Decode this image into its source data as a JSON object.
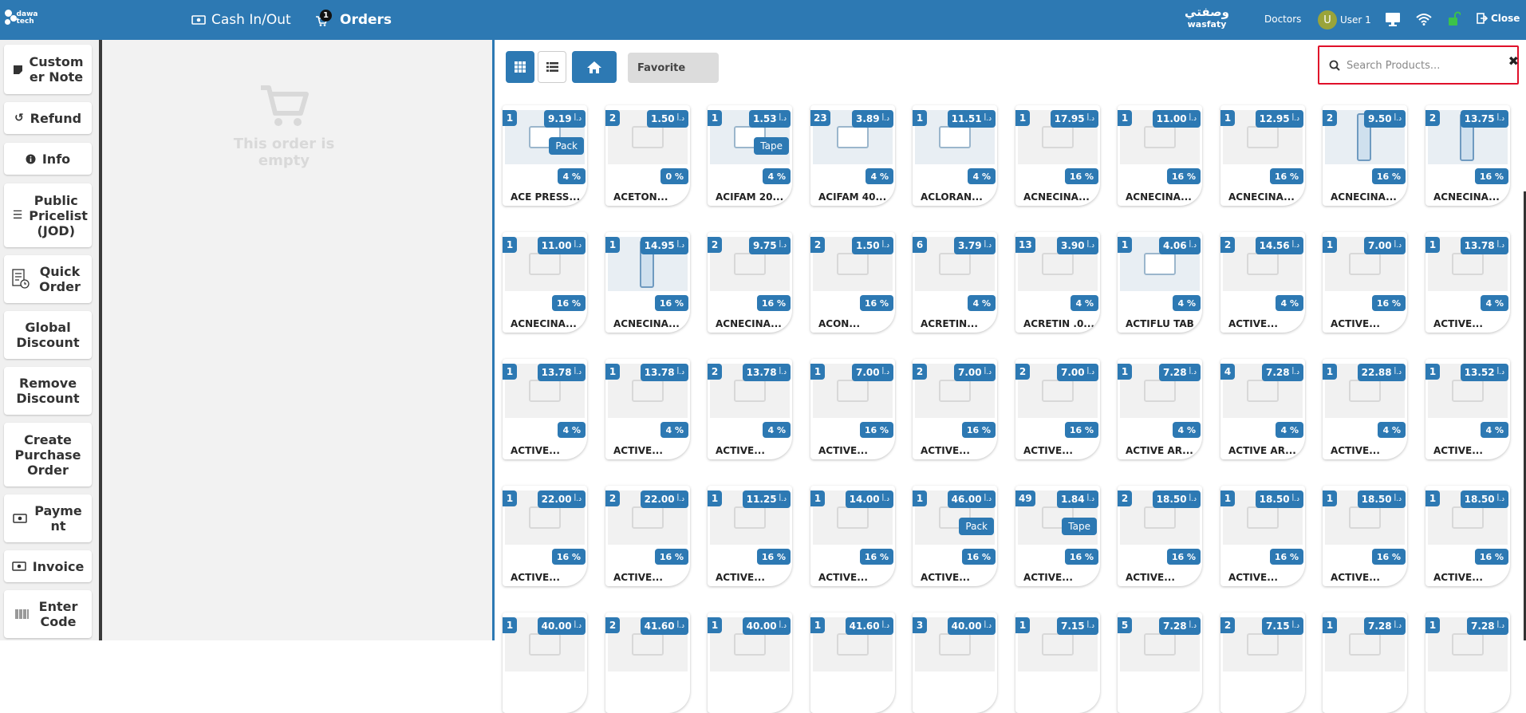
{
  "header": {
    "logo_text": "dawa tech",
    "cash_label": "Cash In/Out",
    "orders_label": "Orders",
    "orders_count": "1",
    "wasfaty_ar": "وصفتي",
    "wasfaty_en": "wasfaty",
    "doctors_label": "Doctors",
    "user_initial": "U",
    "user_label": "User 1",
    "close_label": "Close"
  },
  "actions": [
    {
      "label": "Custom er Note",
      "icon": "note-icon"
    },
    {
      "label": "Refund",
      "icon": "undo-icon"
    },
    {
      "label": "Info",
      "icon": "info-icon"
    },
    {
      "label": "Public Pricelist (JOD)",
      "icon": "list-icon"
    },
    {
      "label": "Quick Order",
      "icon": "clock-doc-icon"
    },
    {
      "label": "Global Discount",
      "icon": ""
    },
    {
      "label": "Remove Discount",
      "icon": ""
    },
    {
      "label": "Create Purchase Order",
      "icon": ""
    },
    {
      "label": "Payme nt",
      "icon": "money-icon"
    },
    {
      "label": "Invoice",
      "icon": "money-icon"
    },
    {
      "label": "Enter Code",
      "icon": "barcode-icon"
    }
  ],
  "order": {
    "empty_text": "This order is empty"
  },
  "toolbar": {
    "favorite_label": "Favorite",
    "search_placeholder": "Search Products..."
  },
  "currency": "د.أ",
  "products": [
    [
      {
        "qty": "1",
        "price": "9.19",
        "unit": "Pack",
        "tax": "4 %",
        "name": "ACE PRESS...",
        "img": "real"
      },
      {
        "qty": "2",
        "price": "1.50",
        "unit": "",
        "tax": "0 %",
        "name": "ACETON...",
        "img": "ph"
      },
      {
        "qty": "1",
        "price": "1.53",
        "unit": "Tape",
        "tax": "4 %",
        "name": "ACIFAM 20...",
        "img": "real"
      },
      {
        "qty": "23",
        "price": "3.89",
        "unit": "",
        "tax": "4 %",
        "name": "ACIFAM 40...",
        "img": "real"
      },
      {
        "qty": "1",
        "price": "11.51",
        "unit": "",
        "tax": "4 %",
        "name": "ACLORAN...",
        "img": "real"
      },
      {
        "qty": "1",
        "price": "17.95",
        "unit": "",
        "tax": "16 %",
        "name": "ACNECINA...",
        "img": "ph"
      },
      {
        "qty": "1",
        "price": "11.00",
        "unit": "",
        "tax": "16 %",
        "name": "ACNECINA...",
        "img": "ph"
      },
      {
        "qty": "1",
        "price": "12.95",
        "unit": "",
        "tax": "16 %",
        "name": "ACNECINA...",
        "img": "ph"
      },
      {
        "qty": "2",
        "price": "9.50",
        "unit": "",
        "tax": "16 %",
        "name": "ACNECINA...",
        "img": "tube"
      },
      {
        "qty": "2",
        "price": "13.75",
        "unit": "",
        "tax": "16 %",
        "name": "ACNECINA...",
        "img": "tube"
      }
    ],
    [
      {
        "qty": "1",
        "price": "11.00",
        "unit": "",
        "tax": "16 %",
        "name": "ACNECINA...",
        "img": "ph"
      },
      {
        "qty": "1",
        "price": "14.95",
        "unit": "",
        "tax": "16 %",
        "name": "ACNECINA...",
        "img": "tube"
      },
      {
        "qty": "2",
        "price": "9.75",
        "unit": "",
        "tax": "16 %",
        "name": "ACNECINA...",
        "img": "ph"
      },
      {
        "qty": "2",
        "price": "1.50",
        "unit": "",
        "tax": "16 %",
        "name": "ACON...",
        "img": "ph"
      },
      {
        "qty": "6",
        "price": "3.79",
        "unit": "",
        "tax": "4 %",
        "name": "ACRETIN...",
        "img": "ph"
      },
      {
        "qty": "13",
        "price": "3.90",
        "unit": "",
        "tax": "4 %",
        "name": "ACRETIN .0...",
        "img": "ph"
      },
      {
        "qty": "1",
        "price": "4.06",
        "unit": "",
        "tax": "4 %",
        "name": "ACTIFLU TAB",
        "img": "real"
      },
      {
        "qty": "2",
        "price": "14.56",
        "unit": "",
        "tax": "4 %",
        "name": "ACTIVE...",
        "img": "ph"
      },
      {
        "qty": "1",
        "price": "7.00",
        "unit": "",
        "tax": "16 %",
        "name": "ACTIVE...",
        "img": "ph"
      },
      {
        "qty": "1",
        "price": "13.78",
        "unit": "",
        "tax": "4 %",
        "name": "ACTIVE...",
        "img": "ph"
      }
    ],
    [
      {
        "qty": "1",
        "price": "13.78",
        "unit": "",
        "tax": "4 %",
        "name": "ACTIVE...",
        "img": "ph"
      },
      {
        "qty": "1",
        "price": "13.78",
        "unit": "",
        "tax": "4 %",
        "name": "ACTIVE...",
        "img": "ph"
      },
      {
        "qty": "2",
        "price": "13.78",
        "unit": "",
        "tax": "4 %",
        "name": "ACTIVE...",
        "img": "ph"
      },
      {
        "qty": "1",
        "price": "7.00",
        "unit": "",
        "tax": "16 %",
        "name": "ACTIVE...",
        "img": "ph"
      },
      {
        "qty": "2",
        "price": "7.00",
        "unit": "",
        "tax": "16 %",
        "name": "ACTIVE...",
        "img": "ph"
      },
      {
        "qty": "2",
        "price": "7.00",
        "unit": "",
        "tax": "16 %",
        "name": "ACTIVE...",
        "img": "ph"
      },
      {
        "qty": "1",
        "price": "7.28",
        "unit": "",
        "tax": "4 %",
        "name": "ACTIVE AR...",
        "img": "ph"
      },
      {
        "qty": "4",
        "price": "7.28",
        "unit": "",
        "tax": "4 %",
        "name": "ACTIVE AR...",
        "img": "ph"
      },
      {
        "qty": "1",
        "price": "22.88",
        "unit": "",
        "tax": "4 %",
        "name": "ACTIVE...",
        "img": "ph"
      },
      {
        "qty": "1",
        "price": "13.52",
        "unit": "",
        "tax": "4 %",
        "name": "ACTIVE...",
        "img": "ph"
      }
    ],
    [
      {
        "qty": "1",
        "price": "22.00",
        "unit": "",
        "tax": "16 %",
        "name": "ACTIVE...",
        "img": "ph"
      },
      {
        "qty": "2",
        "price": "22.00",
        "unit": "",
        "tax": "16 %",
        "name": "ACTIVE...",
        "img": "ph"
      },
      {
        "qty": "1",
        "price": "11.25",
        "unit": "",
        "tax": "16 %",
        "name": "ACTIVE...",
        "img": "ph"
      },
      {
        "qty": "1",
        "price": "14.00",
        "unit": "",
        "tax": "16 %",
        "name": "ACTIVE...",
        "img": "ph"
      },
      {
        "qty": "1",
        "price": "46.00",
        "unit": "Pack",
        "tax": "16 %",
        "name": "ACTIVE...",
        "img": "ph"
      },
      {
        "qty": "49",
        "price": "1.84",
        "unit": "Tape",
        "tax": "16 %",
        "name": "ACTIVE...",
        "img": "ph"
      },
      {
        "qty": "2",
        "price": "18.50",
        "unit": "",
        "tax": "16 %",
        "name": "ACTIVE...",
        "img": "ph"
      },
      {
        "qty": "1",
        "price": "18.50",
        "unit": "",
        "tax": "16 %",
        "name": "ACTIVE...",
        "img": "ph"
      },
      {
        "qty": "1",
        "price": "18.50",
        "unit": "",
        "tax": "16 %",
        "name": "ACTIVE...",
        "img": "ph"
      },
      {
        "qty": "1",
        "price": "18.50",
        "unit": "",
        "tax": "16 %",
        "name": "ACTIVE...",
        "img": "ph"
      }
    ],
    [
      {
        "qty": "1",
        "price": "40.00",
        "unit": "",
        "tax": "",
        "name": "",
        "img": "ph"
      },
      {
        "qty": "2",
        "price": "41.60",
        "unit": "",
        "tax": "",
        "name": "",
        "img": "ph"
      },
      {
        "qty": "1",
        "price": "40.00",
        "unit": "",
        "tax": "",
        "name": "",
        "img": "ph"
      },
      {
        "qty": "1",
        "price": "41.60",
        "unit": "",
        "tax": "",
        "name": "",
        "img": "ph"
      },
      {
        "qty": "3",
        "price": "40.00",
        "unit": "",
        "tax": "",
        "name": "",
        "img": "ph"
      },
      {
        "qty": "1",
        "price": "7.15",
        "unit": "",
        "tax": "",
        "name": "",
        "img": "ph"
      },
      {
        "qty": "5",
        "price": "7.28",
        "unit": "",
        "tax": "",
        "name": "",
        "img": "ph"
      },
      {
        "qty": "2",
        "price": "7.15",
        "unit": "",
        "tax": "",
        "name": "",
        "img": "ph"
      },
      {
        "qty": "1",
        "price": "7.28",
        "unit": "",
        "tax": "",
        "name": "",
        "img": "ph"
      },
      {
        "qty": "1",
        "price": "7.28",
        "unit": "",
        "tax": "",
        "name": "",
        "img": "ph"
      }
    ]
  ],
  "colors": {
    "brand": "#2d79b3",
    "highlight": "#e0102a"
  }
}
